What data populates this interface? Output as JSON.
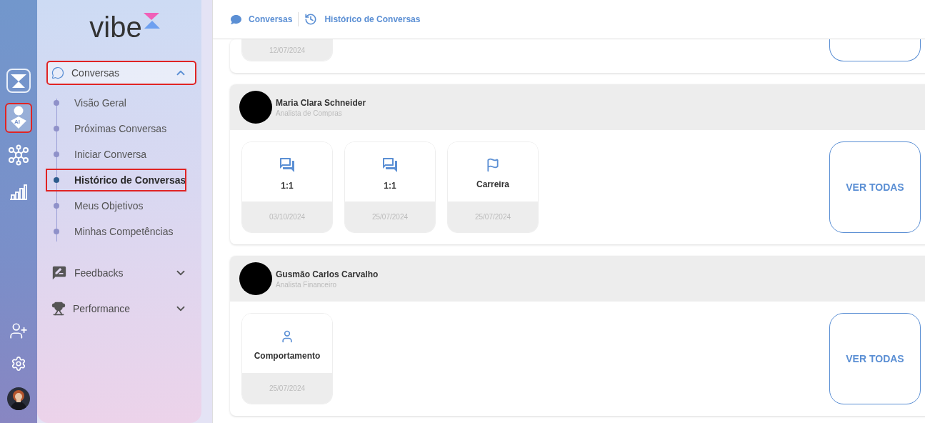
{
  "rail": {
    "items": [
      {
        "kind": "logo",
        "selected": false,
        "highlighted": false
      },
      {
        "kind": "ai-person",
        "badge": "AI",
        "selected": true,
        "highlighted": true
      },
      {
        "kind": "network",
        "selected": false,
        "highlighted": false
      },
      {
        "kind": "chart",
        "selected": false,
        "highlighted": false
      }
    ],
    "bottom": [
      {
        "kind": "add-user"
      },
      {
        "kind": "settings"
      },
      {
        "kind": "avatar"
      }
    ]
  },
  "sidebar": {
    "logo": "vibe",
    "menu": [
      {
        "label": "Conversas",
        "kind": "chat",
        "expanded": true,
        "highlighted": true,
        "children": [
          {
            "label": "Visão Geral",
            "selected": false,
            "highlighted": false
          },
          {
            "label": "Próximas Conversas",
            "selected": false,
            "highlighted": false
          },
          {
            "label": "Iniciar Conversa",
            "selected": false,
            "highlighted": false
          },
          {
            "label": "Histórico de Conversas",
            "selected": true,
            "highlighted": true
          },
          {
            "label": "Meus Objetivos",
            "selected": false,
            "highlighted": false
          },
          {
            "label": "Minhas Competências",
            "selected": false,
            "highlighted": false
          }
        ]
      },
      {
        "label": "Feedbacks",
        "kind": "feedback",
        "expanded": false,
        "highlighted": false
      },
      {
        "label": "Performance",
        "kind": "trophy",
        "expanded": false,
        "highlighted": false
      }
    ]
  },
  "breadcrumb": [
    {
      "label": "Conversas",
      "kind": "chat"
    },
    {
      "label": "Histórico de Conversas",
      "kind": "history"
    }
  ],
  "people": [
    {
      "kind": "partial",
      "conversations": [
        {
          "date": "12/07/2024"
        }
      ]
    },
    {
      "kind": "full",
      "name": "Maria Clara Schneider",
      "role": "Analista de Compras",
      "view_all": "VER TODAS",
      "conversations": [
        {
          "kind": "one-on-one",
          "label": "1:1",
          "date": "03/10/2024"
        },
        {
          "kind": "one-on-one",
          "label": "1:1",
          "date": "25/07/2024"
        },
        {
          "kind": "career",
          "label": "Carreira",
          "date": "25/07/2024"
        }
      ]
    },
    {
      "kind": "full",
      "name": "Gusmão Carlos Carvalho",
      "role": "Analista Financeiro",
      "view_all": "VER TODAS",
      "conversations": [
        {
          "kind": "behavior",
          "label": "Comportamento",
          "date": "25/07/2024"
        }
      ]
    }
  ]
}
